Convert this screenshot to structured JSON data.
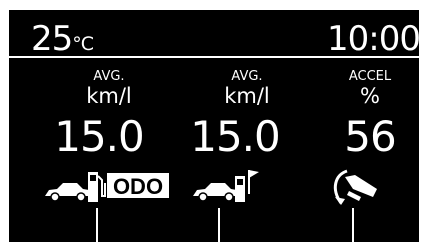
{
  "header": {
    "temperature_value": "25",
    "temperature_unit": "°C",
    "clock": "10:00"
  },
  "columns": [
    {
      "top_label": "AVG.",
      "unit": "km/l",
      "value": "15.0",
      "icon": "car-fuel-odo-icon",
      "icon_text": "ODO"
    },
    {
      "top_label": "AVG.",
      "unit": "km/l",
      "value": "15.0",
      "icon": "car-fuel-refill-icon"
    },
    {
      "top_label": "ACCEL",
      "unit": "%",
      "value": "56",
      "icon": "accelerator-pedal-icon"
    }
  ],
  "colors": {
    "background": "#000000",
    "foreground": "#ffffff",
    "frame": "#ffffff"
  }
}
